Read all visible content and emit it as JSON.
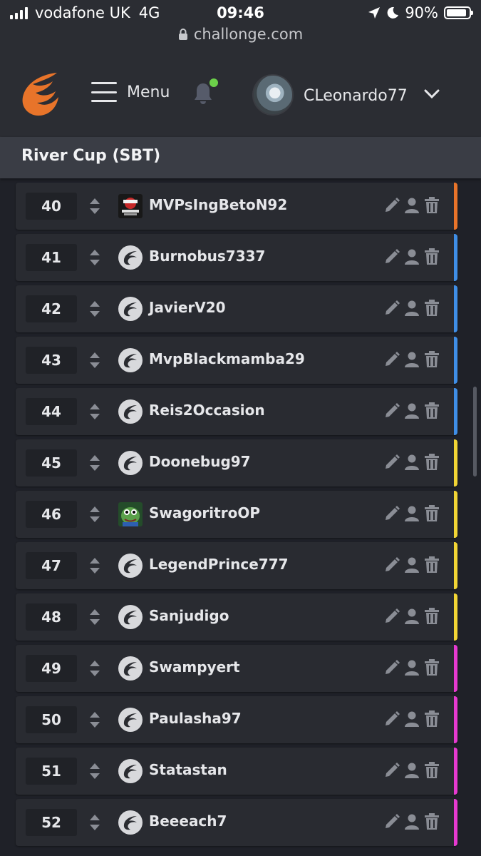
{
  "status_bar": {
    "carrier": "vodafone UK",
    "network": "4G",
    "time": "09:46",
    "battery": "90%",
    "url": "challonge.com"
  },
  "header": {
    "menu_label": "Menu",
    "username": "CLeonardo77",
    "notification_dot": true
  },
  "tournament": {
    "title": "River Cup (SBT)"
  },
  "colors": {
    "orange": "#e8742a",
    "blue": "#3f8ee6",
    "yellow": "#f2d535",
    "magenta": "#e63ad0"
  },
  "participants": [
    {
      "seed": "40",
      "name": "MVPsIngBetoN92",
      "avatar": "custom-dark",
      "group_color": "#e8742a"
    },
    {
      "seed": "41",
      "name": "Burnobus7337",
      "avatar": "challonge-logo",
      "group_color": "#3f8ee6"
    },
    {
      "seed": "42",
      "name": "JavierV20",
      "avatar": "challonge-logo",
      "group_color": "#3f8ee6"
    },
    {
      "seed": "43",
      "name": "MvpBlackmamba29",
      "avatar": "challonge-logo",
      "group_color": "#3f8ee6"
    },
    {
      "seed": "44",
      "name": "Reis2Occasion",
      "avatar": "challonge-logo",
      "group_color": "#3f8ee6"
    },
    {
      "seed": "45",
      "name": "Doonebug97",
      "avatar": "challonge-logo",
      "group_color": "#f2d535"
    },
    {
      "seed": "46",
      "name": "SwagoritroOP",
      "avatar": "custom-green",
      "group_color": "#f2d535"
    },
    {
      "seed": "47",
      "name": "LegendPrince777",
      "avatar": "challonge-logo",
      "group_color": "#f2d535"
    },
    {
      "seed": "48",
      "name": "Sanjudigo",
      "avatar": "challonge-logo",
      "group_color": "#f2d535"
    },
    {
      "seed": "49",
      "name": "Swampyert",
      "avatar": "challonge-logo",
      "group_color": "#e63ad0"
    },
    {
      "seed": "50",
      "name": "Paulasha97",
      "avatar": "challonge-logo",
      "group_color": "#e63ad0"
    },
    {
      "seed": "51",
      "name": "Statastan",
      "avatar": "challonge-logo",
      "group_color": "#e63ad0"
    },
    {
      "seed": "52",
      "name": "Beeeach7",
      "avatar": "challonge-logo",
      "group_color": "#e63ad0"
    }
  ]
}
